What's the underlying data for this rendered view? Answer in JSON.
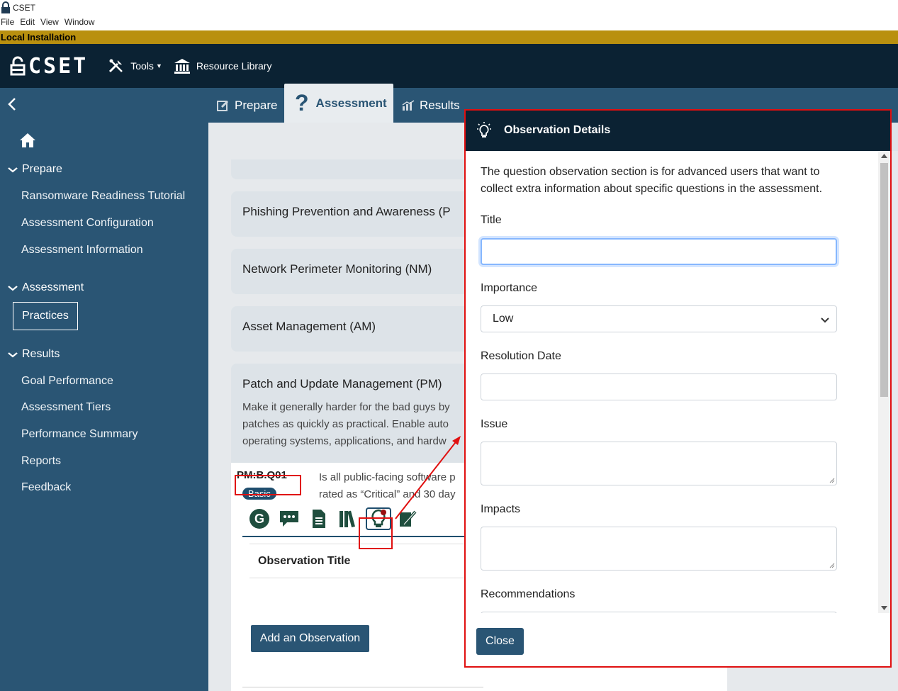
{
  "window": {
    "title": "CSET"
  },
  "menu": [
    "File",
    "Edit",
    "View",
    "Window"
  ],
  "install_banner": "Local Installation",
  "topnav": {
    "logo": "CSET",
    "tools": "Tools",
    "resource_library": "Resource Library"
  },
  "tabs": [
    {
      "label": "Prepare"
    },
    {
      "label": "Assessment"
    },
    {
      "label": "Results"
    }
  ],
  "sidebar": {
    "prepare": {
      "label": "Prepare",
      "items": [
        "Ransomware Readiness Tutorial",
        "Assessment Configuration",
        "Assessment Information"
      ]
    },
    "assessment": {
      "label": "Assessment",
      "items": [
        "Practices"
      ]
    },
    "results": {
      "label": "Results",
      "items": [
        "Goal Performance",
        "Assessment Tiers",
        "Performance Summary",
        "Reports",
        "Feedback"
      ]
    }
  },
  "main": {
    "cards": [
      {
        "title": "Phishing Prevention and Awareness (P"
      },
      {
        "title": "Network Perimeter Monitoring (NM)"
      },
      {
        "title": "Asset Management (AM)"
      },
      {
        "title": "Patch and Update Management (PM)",
        "description": "Make it generally harder for the bad guys by patches as quickly as practical. Enable auto operating systems, applications, and hardw"
      }
    ],
    "question": {
      "id": "PM:B.Q01",
      "badge": "Basic",
      "text": "Is all public-facing software p rated as “Critical” and 30 day"
    },
    "observation_column": "Observation Title",
    "add_button": "Add an Observation"
  },
  "modal": {
    "title": "Observation Details",
    "intro": "The question observation section is for advanced users that want to collect extra information about specific questions in the assessment.",
    "fields": {
      "title": {
        "label": "Title",
        "value": ""
      },
      "importance": {
        "label": "Importance",
        "value": "Low"
      },
      "resolution_date": {
        "label": "Resolution Date",
        "value": ""
      },
      "issue": {
        "label": "Issue",
        "value": ""
      },
      "impacts": {
        "label": "Impacts",
        "value": ""
      },
      "recommendations": {
        "label": "Recommendations",
        "value": ""
      }
    },
    "close_button": "Close"
  },
  "colors": {
    "nav_dark": "#0b2233",
    "nav_blue": "#2a5574",
    "banner": "#b9900f",
    "highlight": "#e01010"
  }
}
